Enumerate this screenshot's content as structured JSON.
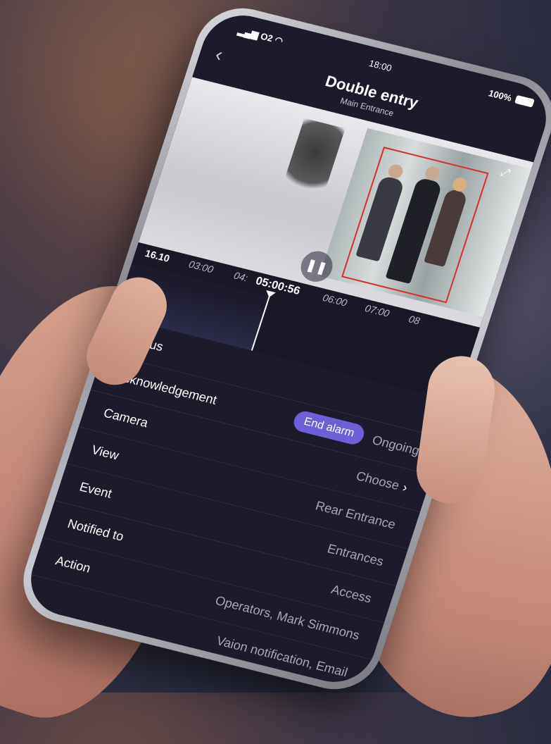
{
  "status_bar": {
    "carrier": "O2",
    "time": "18:00",
    "battery": "100%"
  },
  "header": {
    "title": "Double entry",
    "subtitle": "Main Entrance"
  },
  "timeline": {
    "start": "16.10",
    "labels": [
      "03:00",
      "04:",
      "06:00",
      "07:00",
      "08"
    ],
    "current_time": "05:00:56"
  },
  "details": {
    "status_label": "Status",
    "end_alarm_label": "End alarm",
    "acknowledgement_label": "Acknowledgement",
    "acknowledgement_value": "Ongoing",
    "camera_label": "Camera",
    "camera_value": "Choose",
    "view_label": "View",
    "view_value": "Rear Entrance",
    "event_label": "Event",
    "event_value": "Entrances",
    "notified_label": "Notified to",
    "notified_value": "Access",
    "action_label": "Action",
    "action_value": "Operators, Mark Simmons",
    "extra_value": "Vaion notification, Email"
  },
  "colors": {
    "accent": "#6d5fd8",
    "alarm_box": "#d6302e",
    "screen_bg": "#1d1b2b"
  }
}
